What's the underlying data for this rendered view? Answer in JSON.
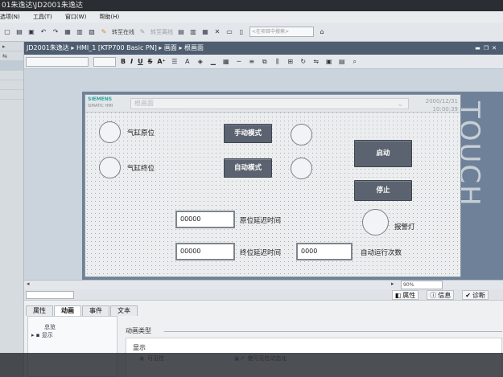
{
  "titlebar": {
    "text": "01朱逸达\\JD2001朱逸达"
  },
  "menu": {
    "items": [
      "选项(N)",
      "工具(T)",
      "窗口(W)",
      "帮助(H)"
    ]
  },
  "toolbar": {
    "online_label": "转至在线",
    "offline_label": "转至离线",
    "search_placeholder": "<在项目中搜索>"
  },
  "breadcrumb": {
    "text": "JD2001朱逸达 ▸ HMI_1 [KTP700 Basic PN] ▸ 画面 ▸ 根画面"
  },
  "format": {
    "bold": "B",
    "italic": "I",
    "underline": "U",
    "strike": "S",
    "super": "A⁺"
  },
  "panel": {
    "touch": "TOUCH"
  },
  "hmi": {
    "brand": "SIEMENS",
    "brand_sub": "SIMATIC HMI",
    "screen_name": "根画面",
    "date": "2000/12/31",
    "time": "10:00:39",
    "lbl_origin": "气缸原位",
    "lbl_end": "气缸终位",
    "btn_manual": "手动模式",
    "btn_auto": "自动模式",
    "btn_start": "启动",
    "btn_stop": "停止",
    "lbl_alarm": "报警灯",
    "field1": "00000",
    "field1_lbl": "原位延迟时间",
    "field2": "00000",
    "field2_lbl": "终位延迟时间",
    "field3": "0000",
    "field3_lbl": "自动运行次数"
  },
  "scrollbar": {
    "zoom": "90%"
  },
  "props": {
    "right_tabs": [
      "属性",
      "信息",
      "诊断"
    ],
    "tabs": [
      "属性",
      "动画",
      "事件",
      "文本"
    ],
    "active_tab": "动画",
    "list_overview": "总览",
    "list_display": "显示",
    "anim_type": "动画类型",
    "show": "显示",
    "visibility": "可见性",
    "dynamize": "使可见性动态化"
  }
}
